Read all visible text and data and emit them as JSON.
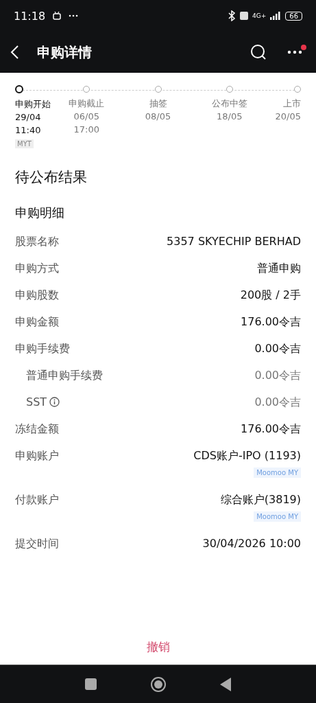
{
  "status_bar": {
    "time": "11:18",
    "network": "4G+",
    "battery": "66"
  },
  "header": {
    "title": "申购详情",
    "notification_dot": true
  },
  "timeline": [
    {
      "label": "申购开始",
      "date": "29/04",
      "time": "11:40",
      "tz": "MYT",
      "selected": true
    },
    {
      "label": "申购截止",
      "date": "06/05",
      "time": "17:00",
      "selected": false
    },
    {
      "label": "抽签",
      "date": "08/05",
      "selected": false
    },
    {
      "label": "公布中签",
      "date": "18/05",
      "selected": false
    },
    {
      "label": "上市",
      "date": "20/05",
      "selected": false
    }
  ],
  "status": "待公布结果",
  "section_title": "申购明细",
  "rows": [
    {
      "kind": "main",
      "label": "股票名称",
      "value": "5357 SKYECHIP BERHAD"
    },
    {
      "kind": "main",
      "label": "申购方式",
      "value": "普通申购"
    },
    {
      "kind": "main",
      "label": "申购股数",
      "value": "200股 / 2手"
    },
    {
      "kind": "main",
      "label": "申购金额",
      "value": "176.00令吉"
    },
    {
      "kind": "main",
      "label": "申购手续费",
      "value": "0.00令吉"
    },
    {
      "kind": "sub",
      "label": "普通申购手续费",
      "value": "0.00令吉"
    },
    {
      "kind": "sub",
      "label": "SST",
      "value": "0.00令吉",
      "info": true
    },
    {
      "kind": "main",
      "label": "冻结金额",
      "value": "176.00令吉"
    },
    {
      "kind": "main",
      "label": "申购账户",
      "value": "CDS账户-IPO (1193)",
      "tag": "Moomoo MY"
    },
    {
      "kind": "main",
      "label": "付款账户",
      "value": "综合账户(3819)",
      "tag": "Moomoo MY"
    },
    {
      "kind": "main",
      "label": "提交时间",
      "value": "30/04/2026 10:00"
    }
  ],
  "cancel_button": "撤销"
}
